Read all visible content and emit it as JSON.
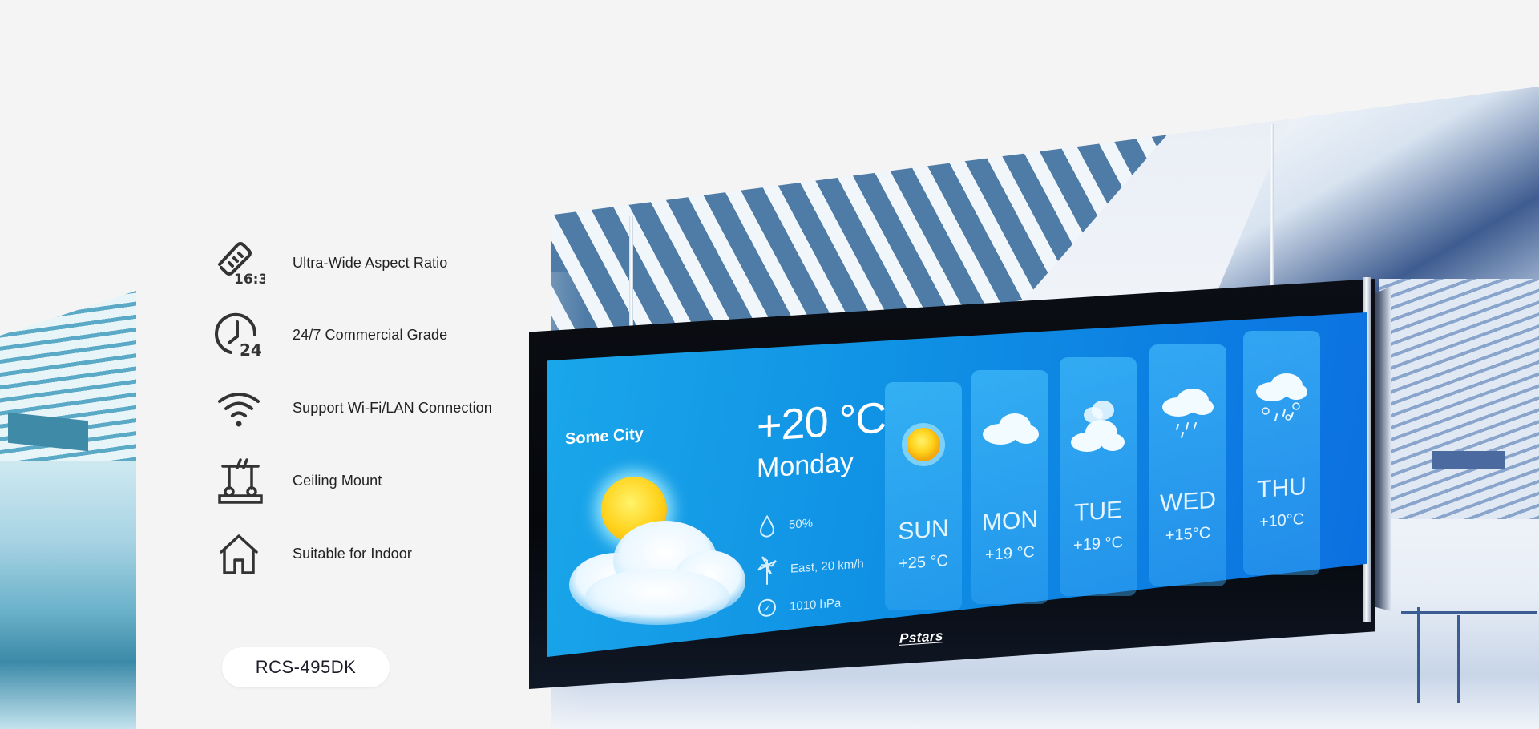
{
  "features": [
    {
      "icon": "aspect-ratio-ruler-icon",
      "icon_text": "16:3",
      "label": "Ultra-Wide Aspect Ratio"
    },
    {
      "icon": "clock-24-icon",
      "icon_text": "24",
      "label": "24/7 Commercial Grade"
    },
    {
      "icon": "wifi-icon",
      "label": "Support Wi-Fi/LAN Connection"
    },
    {
      "icon": "ceiling-mount-icon",
      "label": "Ceiling Mount"
    },
    {
      "icon": "house-icon",
      "label": "Suitable for Indoor"
    }
  ],
  "model": "RCS-495DK",
  "device": {
    "brand": "Pstars"
  },
  "weather_screen": {
    "city": "Some City",
    "current": {
      "temperature": "+20 °C",
      "day": "Monday",
      "condition": "partly-cloudy",
      "humidity": "50%",
      "wind": "East, 20 km/h",
      "pressure": "1010 hPa"
    },
    "forecast": [
      {
        "day": "SUN",
        "temp": "+25 °C",
        "condition": "sunny"
      },
      {
        "day": "MON",
        "temp": "+19 °C",
        "condition": "cloudy"
      },
      {
        "day": "TUE",
        "temp": "+19 °C",
        "condition": "overcast"
      },
      {
        "day": "WED",
        "temp": "+15°C",
        "condition": "rain"
      },
      {
        "day": "THU",
        "temp": "+10°C",
        "condition": "sleet"
      }
    ]
  },
  "colors": {
    "page_bg": "#f4f4f4",
    "screen_blue": "#0f8fe4",
    "text_dark": "#222222",
    "icon_dark": "#333333"
  }
}
